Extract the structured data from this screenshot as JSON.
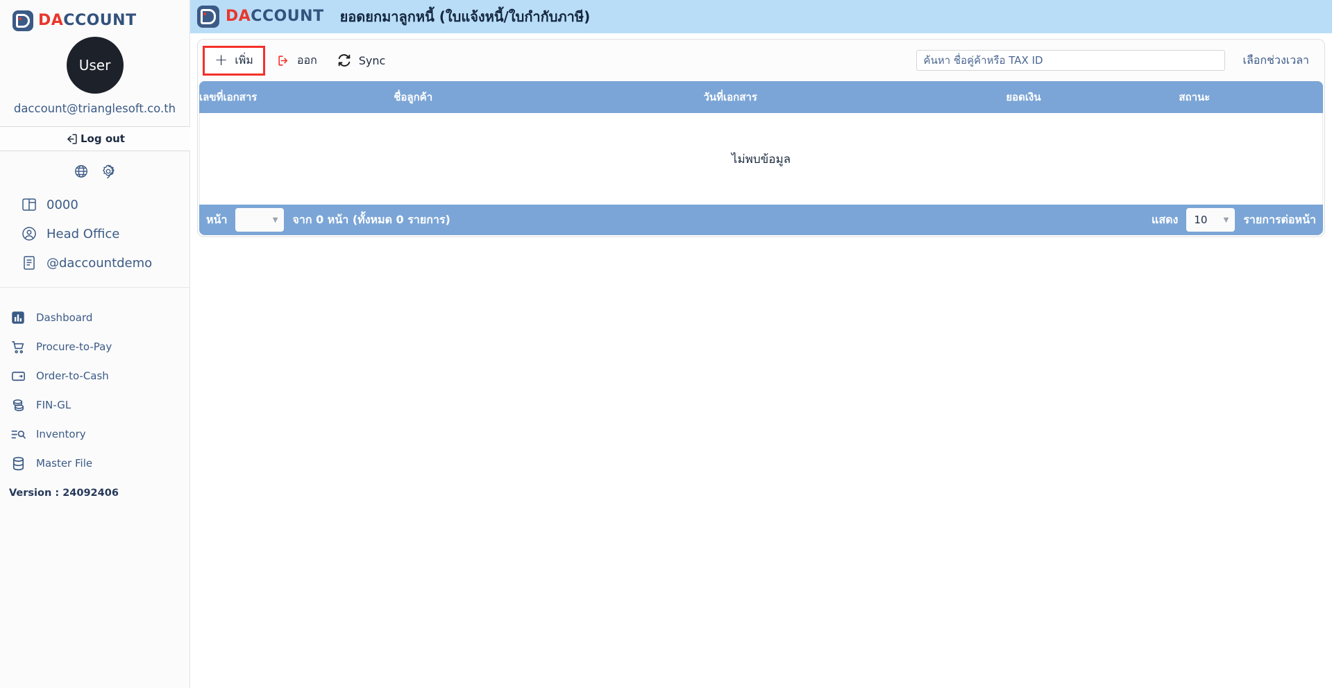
{
  "brand": {
    "name_red": "DA",
    "name_blue": "CCOUNT",
    "logo_icon": "daccount-logo-icon"
  },
  "sidebar": {
    "avatar_label": "User",
    "user_email": "daccount@trianglesoft.co.th",
    "logout_label": "Log out",
    "quick_icons": [
      {
        "name": "globe-icon",
        "label": "globe"
      },
      {
        "name": "gear-icon",
        "label": "settings"
      }
    ],
    "org_items": [
      {
        "label": "0000",
        "icon": "book-icon"
      },
      {
        "label": "Head Office",
        "icon": "user-circle-icon"
      },
      {
        "label": "@daccountdemo",
        "icon": "document-icon"
      }
    ],
    "nav_items": [
      {
        "label": "Dashboard",
        "icon": "dashboard-icon"
      },
      {
        "label": "Procure-to-Pay",
        "icon": "cart-icon"
      },
      {
        "label": "Order-to-Cash",
        "icon": "wallet-icon"
      },
      {
        "label": "FIN-GL",
        "icon": "coins-icon"
      },
      {
        "label": "Inventory",
        "icon": "inventory-icon"
      },
      {
        "label": "Master File",
        "icon": "database-icon"
      }
    ],
    "version": "Version : 24092406"
  },
  "header": {
    "title": "ยอดยกมาลูกหนี้ (ใบแจ้งหนี้/ใบกำกับภาษี)",
    "background_color": "#b9ddf7"
  },
  "toolbar": {
    "add_label": "เพิ่ม",
    "add_icon": "plus-icon",
    "export_label": "ออก",
    "export_icon": "export-arrow-icon",
    "sync_label": "Sync",
    "sync_icon": "sync-icon",
    "date_range_label": "เลือกช่วงเวลา",
    "highlight_color": "#f4302a"
  },
  "search": {
    "placeholder": "ค้นหา ชื่อคู่ค้าหรือ TAX ID",
    "value": ""
  },
  "table": {
    "header_color": "#7ba5d6",
    "columns": [
      {
        "key": "doc_no",
        "label": "เลขที่เอกสาร"
      },
      {
        "key": "customer",
        "label": "ชื่อลูกค้า"
      },
      {
        "key": "doc_date",
        "label": "วันที่เอกสาร"
      },
      {
        "key": "amount",
        "label": "ยอดเงิน"
      },
      {
        "key": "status",
        "label": "สถานะ"
      }
    ],
    "rows": [],
    "empty_message": "ไม่พบข้อมูล"
  },
  "pagination": {
    "page_label": "หน้า",
    "page_value": "",
    "of_pages_text": "จาก 0 หน้า (ทั้งหมด 0 รายการ)",
    "show_label": "แสดง",
    "page_size_value": "10",
    "per_page_label": "รายการต่อหน้า"
  }
}
